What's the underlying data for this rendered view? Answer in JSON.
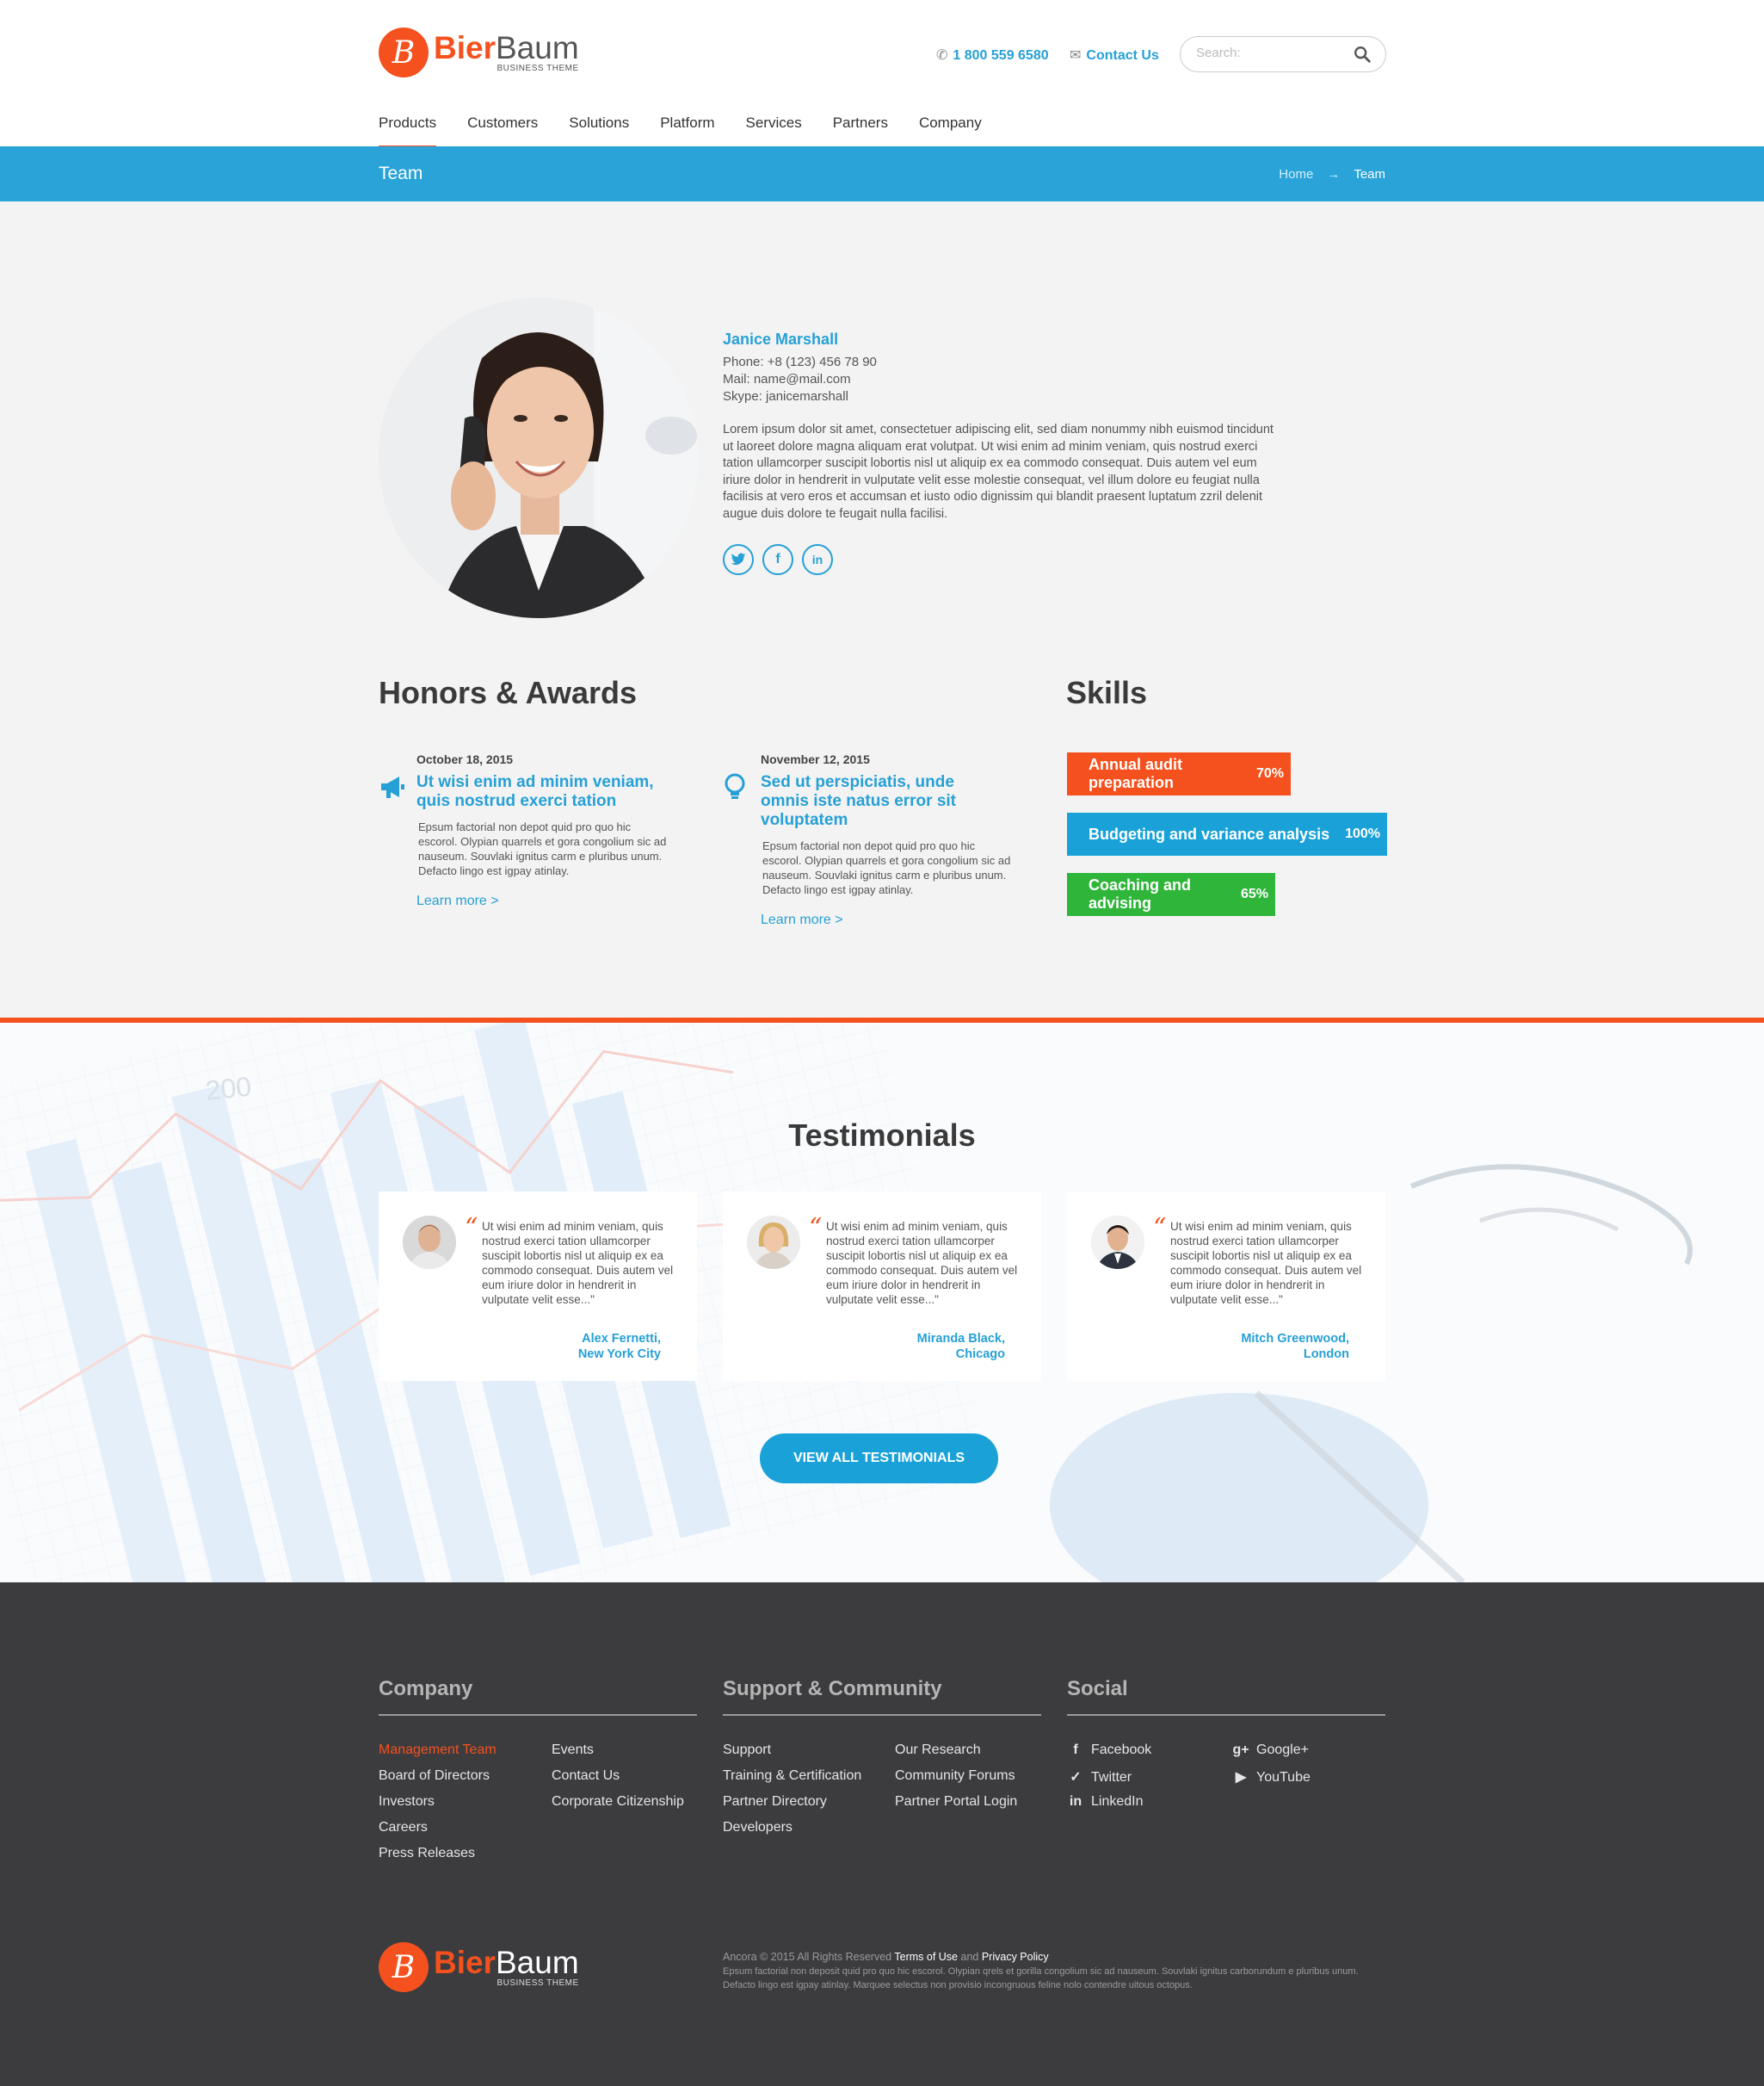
{
  "brand": {
    "logo_letter": "B",
    "name_bold": "Bier",
    "name_rest": "Baum",
    "tagline": "BUSINESS THEME",
    "accent": "#f4511e",
    "blue": "#29a3d8"
  },
  "header": {
    "phone_icon": "phone-icon",
    "phone": "1 800 559 6580",
    "contact_icon": "envelope-icon",
    "contact": "Contact Us",
    "search_placeholder": "Search:"
  },
  "nav": {
    "items": [
      "Products",
      "Customers",
      "Solutions",
      "Platform",
      "Services",
      "Partners",
      "Company"
    ],
    "active": "Products"
  },
  "titlebar": {
    "title": "Team",
    "crumb_home": "Home",
    "crumb_sep": "→",
    "crumb_current": "Team"
  },
  "profile": {
    "name": "Janice Marshall",
    "phone": "Phone: +8 (123) 456 78 90",
    "mail": "Mail: name@mail.com",
    "skype": "Skype: janicemarshall",
    "bio": "Lorem ipsum dolor sit amet, consectetuer adipiscing elit, sed diam nonummy nibh euismod tincidunt ut laoreet dolore magna aliquam erat volutpat. Ut wisi enim ad minim veniam, quis nostrud exerci tation ullamcorper suscipit lobortis nisl ut aliquip ex ea commodo consequat. Duis autem vel eum iriure dolor in hendrerit in vulputate velit esse molestie consequat, vel illum dolore eu feugiat nulla facilisis at vero eros et accumsan et iusto odio dignissim qui blandit praesent luptatum zzril delenit augue duis dolore te feugait nulla facilisi.",
    "social": [
      "twitter-icon",
      "facebook-icon",
      "linkedin-icon"
    ]
  },
  "awards": {
    "heading": "Honors & Awards",
    "items": [
      {
        "date": "October 18, 2015",
        "title": "Ut wisi enim ad minim veniam, quis nostrud exerci tation",
        "text": "Epsum factorial non depot quid pro quo hic escorol. Olypian quarrels et gora congolium sic ad nauseum. Souvlaki ignitus carm e pluribus unum. Defacto lingo est igpay atinlay.",
        "link": "Learn more >",
        "icon": "megaphone-icon"
      },
      {
        "date": "November 12, 2015",
        "title": "Sed ut perspiciatis, unde omnis iste natus error sit voluptatem",
        "text": "Epsum factorial non depot quid pro quo hic escorol. Olypian quarrels et gora congolium sic ad nauseum. Souvlaki ignitus carm e pluribus unum. Defacto lingo est igpay atinlay.",
        "link": "Learn more >",
        "icon": "lightbulb-icon"
      }
    ]
  },
  "skills": {
    "heading": "Skills",
    "items": [
      {
        "label": "Annual audit preparation",
        "pct_label": "70%",
        "value": 70,
        "color": "#f4511e"
      },
      {
        "label": "Budgeting and variance analysis",
        "pct_label": "100%",
        "value": 100,
        "color": "#1aa2d8"
      },
      {
        "label": "Coaching and advising",
        "pct_label": "65%",
        "value": 65,
        "color": "#2fb53a"
      }
    ]
  },
  "testimonials": {
    "heading": "Testimonials",
    "quote_mark": "“",
    "items": [
      {
        "text": "Ut wisi enim ad minim veniam, quis nostrud exerci tation ullamcorper suscipit lobortis nisl ut aliquip ex ea commodo consequat. Duis autem vel eum iriure dolor in hendrerit in vulputate velit esse...\"",
        "name": "Alex Fernetti,",
        "city": "New York City"
      },
      {
        "text": "Ut wisi enim ad minim veniam, quis nostrud exerci tation ullamcorper suscipit lobortis nisl ut aliquip ex ea commodo consequat. Duis autem vel eum iriure dolor in hendrerit in vulputate velit esse...\"",
        "name": "Miranda Black,",
        "city": "Chicago"
      },
      {
        "text": "Ut wisi enim ad minim veniam, quis nostrud exerci tation ullamcorper suscipit lobortis nisl ut aliquip ex ea commodo consequat. Duis autem vel eum iriure dolor in hendrerit in vulputate velit esse...\"",
        "name": "Mitch Greenwood,",
        "city": "London"
      }
    ],
    "button": "VIEW ALL TESTIMONIALS",
    "bg_label_200": "200"
  },
  "footer": {
    "company": {
      "title": "Company",
      "col1": [
        "Management Team",
        "Board of Directors",
        "Investors",
        "Careers",
        "Press Releases"
      ],
      "col2": [
        "Events",
        "Contact Us",
        "Corporate Citizenship"
      ]
    },
    "support": {
      "title": "Support & Community",
      "col1": [
        "Support",
        "Training & Certification",
        "Partner Directory",
        "Developers"
      ],
      "col2": [
        "Our Research",
        "Community Forums",
        "Partner Portal Login"
      ]
    },
    "social": {
      "title": "Social",
      "col1": [
        "Facebook",
        "Twitter",
        "LinkedIn"
      ],
      "col2": [
        "Google+",
        "YouTube"
      ]
    },
    "copyright": "Ancora © 2015 All Rights Reserved",
    "terms": "Terms of Use",
    "and": "and",
    "privacy": "Privacy Policy",
    "small": "Epsum factorial non deposit quid pro quo hic escorol. Olypian qrels et gorilla congolium sic ad nauseum. Souvlaki ignitus carborundum e pluribus unum. Defacto lingo est igpay atinlay. Marquee selectus non provisio incongruous feline nolo contendre uitous octopus."
  }
}
